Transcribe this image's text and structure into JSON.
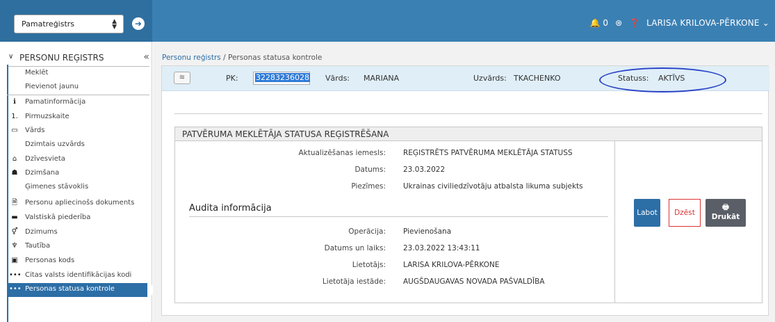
{
  "header": {
    "module_select": "Pamatreģistrs",
    "notif_count": "0",
    "user_name": "LARISA KRILOVA-PĒRKONE"
  },
  "sidebar": {
    "title": "PERSONU REĢISTRS",
    "top_links": [
      "Meklēt",
      "Pievienot jaunu"
    ],
    "items": [
      {
        "label": "Pamatinformācija",
        "icon": "info-icon"
      },
      {
        "label": "Pirmuzskaite",
        "icon": "numbered-one-icon"
      },
      {
        "label": "Vārds",
        "icon": "id-card-icon"
      },
      {
        "label": "Dzimtais uzvārds",
        "icon": ""
      },
      {
        "label": "Dzīvesvieta",
        "icon": "home-icon"
      },
      {
        "label": "Dzimšana",
        "icon": "birth-icon"
      },
      {
        "label": "Ģimenes stāvoklis",
        "icon": ""
      },
      {
        "label": "Personu apliecinošs dokuments",
        "icon": "document-icon"
      },
      {
        "label": "Valstiskā piederība",
        "icon": "flag-icon"
      },
      {
        "label": "Dzimums",
        "icon": "gender-icon"
      },
      {
        "label": "Tautība",
        "icon": "nationality-icon"
      },
      {
        "label": "Personas kods",
        "icon": "code-icon"
      },
      {
        "label": "Citas valsts identifikācijas kodi",
        "icon": "dots-icon"
      },
      {
        "label": "Personas statusa kontrole",
        "icon": "status-icon",
        "active": true
      }
    ]
  },
  "breadcrumb": {
    "link": "Personu reģistrs",
    "separator": "/",
    "current": "Personas statusa kontrole"
  },
  "person": {
    "pk_label": "PK:",
    "pk_value": "32283236028",
    "name_label": "Vārds:",
    "name_value": "MARIANA",
    "surname_label": "Uzvārds:",
    "surname_value": "TKACHENKO",
    "status_label": "Statuss:",
    "status_value": "AKTĪVS"
  },
  "section": {
    "title": "PATVĒRUMA MEKLĒTĀJA STATUSA REĢISTRĒŠANA",
    "fields": [
      {
        "label": "Aktualizēšanas iemesls:",
        "value": "REĢISTRĒTS PATVĒRUMA MEKLĒTĀJA STATUSS"
      },
      {
        "label": "Datums:",
        "value": "23.03.2022"
      },
      {
        "label": "Piezīmes:",
        "value": "Ukrainas civiliedzīvotāju atbalsta likuma subjekts"
      }
    ],
    "audit_title": "Audita informācija",
    "audit_fields": [
      {
        "label": "Operācija:",
        "value": "Pievienošana"
      },
      {
        "label": "Datums un laiks:",
        "value": "23.03.2022 13:43:11"
      },
      {
        "label": "Lietotājs:",
        "value": "LARISA KRILOVA-PĒRKONE"
      },
      {
        "label": "Lietotāja iestāde:",
        "value": "AUGŠDAUGAVAS NOVADA PAŠVALDĪBA"
      }
    ]
  },
  "actions": {
    "edit": "Labot",
    "delete": "Dzēst",
    "print": "Drukāt"
  },
  "colors": {
    "header": "#3b80b3",
    "active_item": "#2c6ea6",
    "status_oval": "#2b44c9",
    "delete": "#dd3333"
  }
}
